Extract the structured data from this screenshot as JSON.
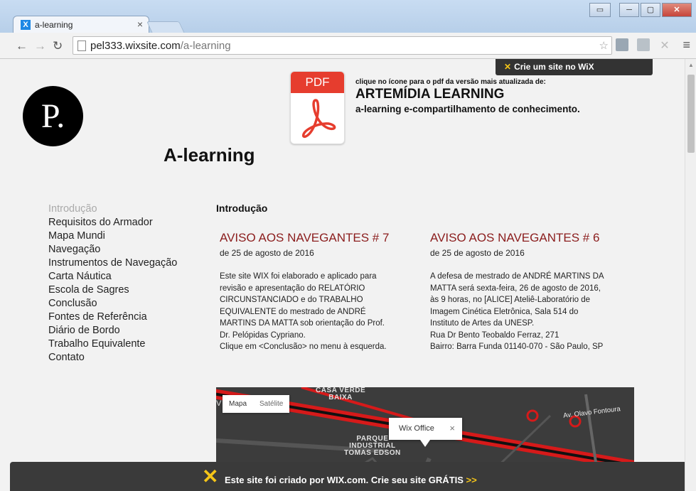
{
  "browser": {
    "tab_title": "a-learning",
    "tab_favicon": "X",
    "tab_close": "×",
    "url_domain": "pel333.wixsite.com",
    "url_path": "/a-learning"
  },
  "wix_top_bar": {
    "text": "Crie um site no WiX"
  },
  "site": {
    "logo_text": "P.",
    "title": "A-learning"
  },
  "pdf_block": {
    "icon_label": "PDF",
    "note": "clique no ícone para o pdf da versão mais atualizada de:",
    "title": "ARTEMÍDIA LEARNING",
    "subtitle": "a-learning e-compartilhamento de conhecimento."
  },
  "sidenav": {
    "items": [
      {
        "label": "Introdução",
        "active": true
      },
      {
        "label": "Requisitos do Armador"
      },
      {
        "label": "Mapa Mundi"
      },
      {
        "label": "Navegação"
      },
      {
        "label": "Instrumentos de Navegação"
      },
      {
        "label": "Carta Náutica"
      },
      {
        "label": "Escola de Sagres"
      },
      {
        "label": "Conclusão"
      },
      {
        "label": "Fontes de Referência"
      },
      {
        "label": "Diário de Bordo"
      },
      {
        "label": "Trabalho Equivalente"
      },
      {
        "label": "Contato"
      }
    ]
  },
  "main": {
    "section_title": "Introdução",
    "posts": [
      {
        "title": "AVISO AOS NAVEGANTES # 7",
        "date": "de 25 de agosto de 2016",
        "body": [
          "Este site WIX foi elaborado e aplicado para",
          "revisão e apresentação do RELATÓRIO",
          "CIRCUNSTANCIADO e do TRABALHO",
          "EQUIVALENTE do mestrado de ANDRÉ",
          "MARTINS DA MATTA sob orientação do Prof.",
          "Dr. Pelópidas Cypriano.",
          "Clique em <Conclusão> no menu à esquerda."
        ]
      },
      {
        "title": "AVISO AOS NAVEGANTES # 6",
        "date": "de 25 de agosto de 2016",
        "body": [
          "A defesa de mestrado de ANDRÉ MARTINS DA",
          "MATTA será sexta-feira, 26 de agosto de 2016,",
          "às 9 horas, no [ALICE] Ateliê-Laboratório de",
          "Imagem Cinética Eletrônica, Sala 514 do",
          "Instituto de Artes da UNESP.",
          "Rua Dr Bento Teobaldo Ferraz, 271",
          "Bairro: Barra Funda 01140-070 - São Paulo, SP"
        ]
      }
    ]
  },
  "map": {
    "tab_map": "Mapa",
    "tab_satellite": "Satélite",
    "label_casa_verde": "CASA VERDE",
    "label_baixa": "BAIXA",
    "label_parque": "PARQUE",
    "label_industrial": "INDUSTRIAL",
    "label_tomas": "TOMAS EDSON",
    "road_label": "Av. Olavo Fontoura",
    "letter_v": "V",
    "info_window": "Wix Office",
    "info_close": "×"
  },
  "wix_banner": {
    "text": "Este site foi criado por WIX.com. Crie seu site GRÁTIS",
    "cta": ">>"
  },
  "colors": {
    "post_title": "#8b1d1d",
    "pdf_red": "#e63d2e",
    "wix_yellow": "#f5c518"
  }
}
